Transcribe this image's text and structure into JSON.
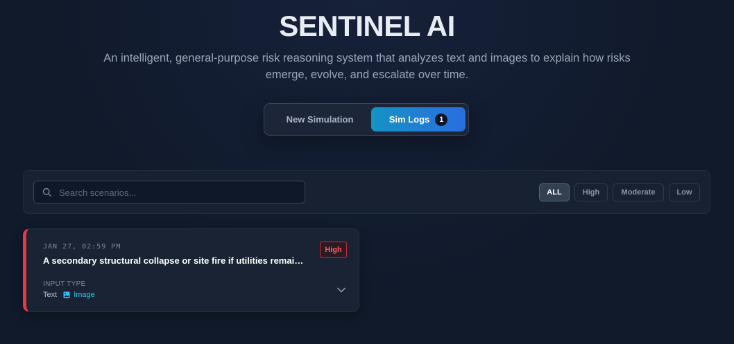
{
  "header": {
    "title": "SENTINEL AI",
    "subtitle": "An intelligent, general-purpose risk reasoning system that analyzes text and images to explain how risks emerge, evolve, and escalate over time."
  },
  "tabs": {
    "new_simulation": "New Simulation",
    "sim_logs": "Sim Logs",
    "sim_logs_count": "1",
    "active": "sim_logs"
  },
  "search": {
    "placeholder": "Search scenarios...",
    "value": ""
  },
  "filters": {
    "items": [
      "ALL",
      "High",
      "Moderate",
      "Low"
    ],
    "active": "ALL"
  },
  "logs": [
    {
      "date": "JAN 27, 02:59 PM",
      "title": "A secondary structural collapse or site fire if utilities remain...",
      "risk": "High",
      "input_type_label": "INPUT TYPE",
      "input_types": [
        "Text",
        "Image"
      ]
    }
  ],
  "colors": {
    "background": "#111a2b",
    "accent_from": "#1592c4",
    "accent_to": "#2a6ee0",
    "high_risk": "#e23b45",
    "image_type": "#33c3f0"
  },
  "icons": {
    "search": "search-icon",
    "image": "image-icon",
    "expand": "chevron-down-icon"
  }
}
